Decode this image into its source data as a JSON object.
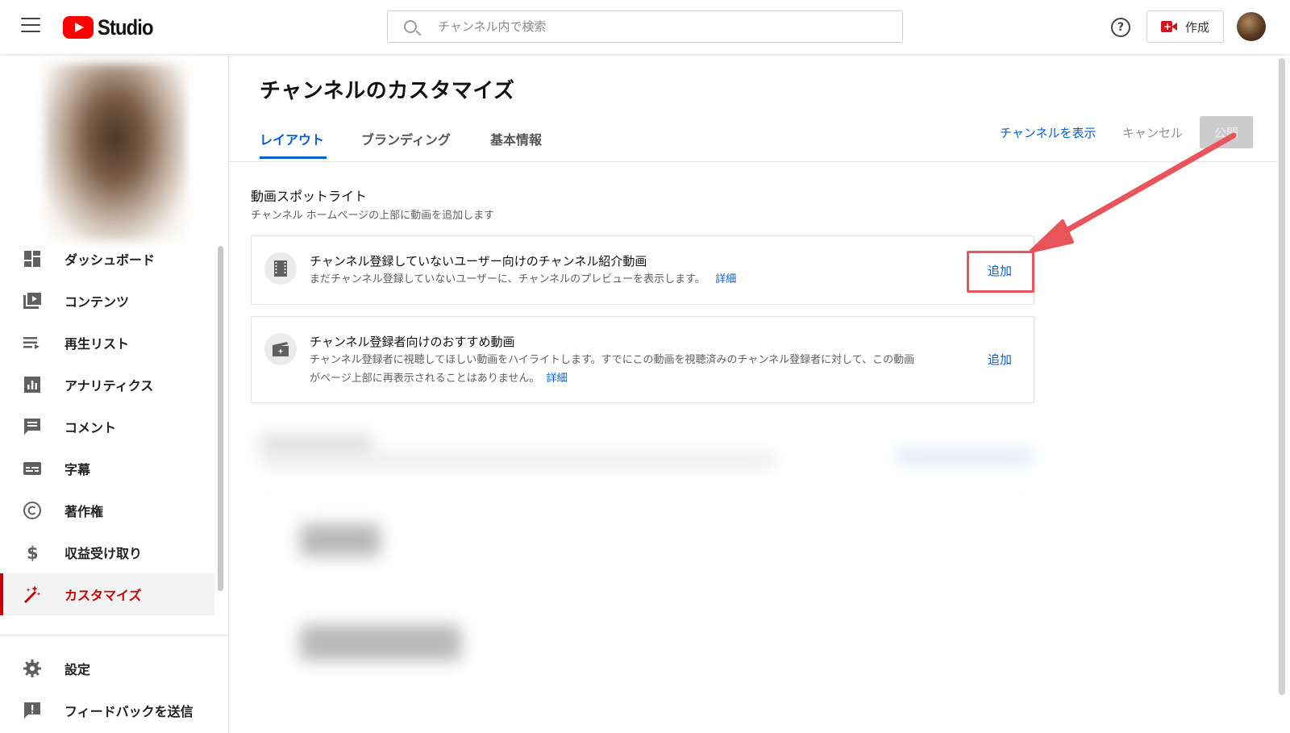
{
  "header": {
    "logo_text": "Studio",
    "search_placeholder": "チャンネル内で検索",
    "create_label": "作成"
  },
  "sidebar": {
    "items": [
      {
        "label": "ダッシュボード",
        "icon": "dashboard-icon"
      },
      {
        "label": "コンテンツ",
        "icon": "content-icon"
      },
      {
        "label": "再生リスト",
        "icon": "playlist-icon"
      },
      {
        "label": "アナリティクス",
        "icon": "analytics-icon"
      },
      {
        "label": "コメント",
        "icon": "comment-icon"
      },
      {
        "label": "字幕",
        "icon": "subtitles-icon"
      },
      {
        "label": "著作権",
        "icon": "copyright-icon"
      },
      {
        "label": "収益受け取り",
        "icon": "dollar-icon"
      },
      {
        "label": "カスタマイズ",
        "icon": "magic-wand-icon",
        "active": true
      },
      {
        "label": "設定",
        "icon": "gear-icon"
      },
      {
        "label": "フィードバックを送信",
        "icon": "feedback-icon"
      }
    ]
  },
  "main": {
    "title": "チャンネルのカスタマイズ",
    "tabs": [
      {
        "label": "レイアウト",
        "active": true
      },
      {
        "label": "ブランディング"
      },
      {
        "label": "基本情報"
      }
    ],
    "actions": {
      "view_channel": "チャンネルを表示",
      "cancel": "キャンセル",
      "publish": "公開"
    },
    "section": {
      "title": "動画スポットライト",
      "subtitle": "チャンネル ホームページの上部に動画を追加します"
    },
    "cards": [
      {
        "title": "チャンネル登録していないユーザー向けのチャンネル紹介動画",
        "desc_line1": "まだチャンネル登録していないユーザーに、チャンネルのプレビューを表示します。",
        "link": "詳細",
        "add": "追加"
      },
      {
        "title": "チャンネル登録者向けのおすすめ動画",
        "desc_line1": "チャンネル登録者に視聴してほしい動画をハイライトします。すでにこの動画を視聴済みのチャンネル登録者に対して、この動画",
        "desc_line2": "がページ上部に再表示されることはありません。",
        "link": "詳細",
        "add": "追加"
      }
    ]
  },
  "colors": {
    "accent_blue": "#065fd4",
    "active_red": "#cc0000",
    "annotation_red": "#e8545a"
  }
}
